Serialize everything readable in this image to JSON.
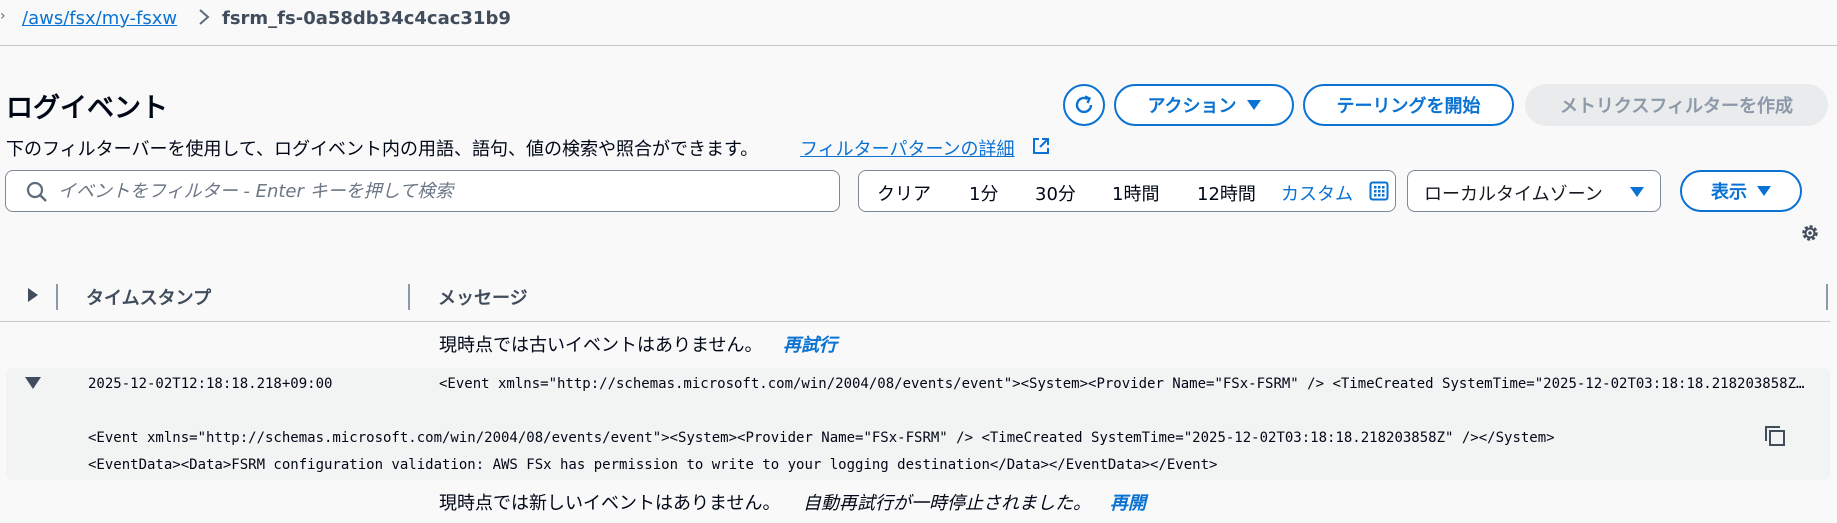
{
  "breadcrumb": {
    "lead": "›",
    "link": "/aws/fsx/my-fsxw",
    "current": "fsrm_fs-0a58db34c4cac31b9"
  },
  "header": {
    "title": "ログイベント",
    "description": "下のフィルターバーを使用して、ログイベント内の用語、語句、値の検索や照合ができます。",
    "details_link": "フィルターパターンの詳細",
    "actions_label": "アクション",
    "tail_label": "テーリングを開始",
    "create_metric_label": "メトリクスフィルターを作成"
  },
  "filter": {
    "placeholder": "イベントをフィルター - Enter キーを押して検索",
    "ranges": [
      "クリア",
      "1分",
      "30分",
      "1時間",
      "12時間"
    ],
    "custom_label": "カスタム",
    "timezone": "ローカルタイムゾーン",
    "view_label": "表示"
  },
  "table": {
    "col_timestamp": "タイムスタンプ",
    "col_message": "メッセージ",
    "older_notice": "現時点では古いイベントはありません。",
    "older_retry": "再試行",
    "event": {
      "timestamp": "2025-12-02T12:18:18.218+09:00",
      "message": "<Event xmlns=\"http://schemas.microsoft.com/win/2004/08/events/event\"><System><Provider Name=\"FSx-FSRM\" /> <TimeCreated SystemTime=\"2025-12-02T03:18:18.218203858Z\" /></System><EventData><Data>FSRM configuration validation: AWS FSx has permission to write to your logging destination</Data></EventData></Event>",
      "detail_line1": "<Event xmlns=\"http://schemas.microsoft.com/win/2004/08/events/event\"><System><Provider Name=\"FSx-FSRM\" /> <TimeCreated SystemTime=\"2025-12-02T03:18:18.218203858Z\" /></System>",
      "detail_line2": "<EventData><Data>FSRM configuration validation: AWS FSx has permission to write to your logging destination</Data></EventData></Event>"
    },
    "newer_notice": "現時点では新しいイベントはありません。",
    "newer_paused": "自動再試行が一時停止されました。",
    "newer_resume": "再開"
  },
  "colors": {
    "accent": "#0972d3",
    "disabled_bg": "#e9ebed",
    "disabled_text": "#8d99a8",
    "row_bg": "#f2f3f3"
  },
  "icons": [
    "refresh-icon",
    "caret-down-icon",
    "external-link-icon",
    "search-icon",
    "calendar-icon",
    "gear-icon",
    "expand-icon",
    "copy-icon",
    "chevron-right-icon"
  ]
}
